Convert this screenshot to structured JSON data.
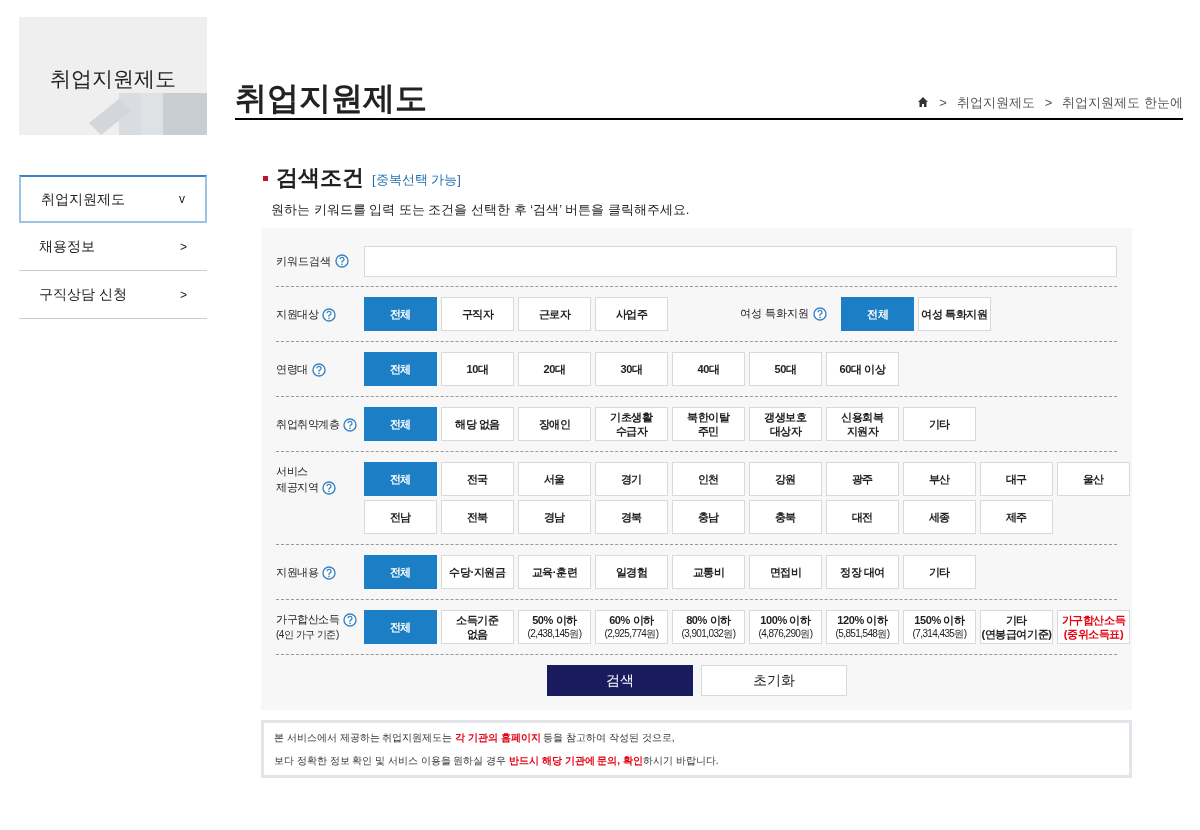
{
  "sidebar": {
    "banner_title": "취업지원제도",
    "items": [
      {
        "label": "취업지원제도",
        "arrow": "v",
        "selected": true
      },
      {
        "label": "채용정보",
        "arrow": ">",
        "selected": false
      },
      {
        "label": "구직상담 신청",
        "arrow": ">",
        "selected": false
      }
    ]
  },
  "header": {
    "title": "취업지원제도",
    "breadcrumb": [
      ">",
      "취업지원제도",
      ">",
      "취업지원제도 한눈에"
    ]
  },
  "section": {
    "title": "검색조건",
    "note": "[중복선택 가능]",
    "description": "원하는 키워드를 입력 또는 조건을 선택한 후 ‘검색’ 버튼을 클릭해주세요."
  },
  "filters": [
    {
      "kind": "keyword",
      "label": "키워드검색"
    },
    {
      "kind": "options",
      "label": "지원대상",
      "groups": [
        {
          "options": [
            {
              "label": "전체",
              "selected": true
            },
            {
              "label": "구직자",
              "selected": false
            },
            {
              "label": "근로자",
              "selected": false
            },
            {
              "label": "사업주",
              "selected": false
            }
          ]
        },
        {
          "label": "여성 특화지원",
          "options": [
            {
              "label": "전체",
              "selected": true
            },
            {
              "label": "여성 특화지원",
              "selected": false
            }
          ]
        }
      ]
    },
    {
      "kind": "options",
      "label": "연령대",
      "groups": [
        {
          "options": [
            {
              "label": "전체",
              "selected": true
            },
            {
              "label": "10대",
              "selected": false
            },
            {
              "label": "20대",
              "selected": false
            },
            {
              "label": "30대",
              "selected": false
            },
            {
              "label": "40대",
              "selected": false
            },
            {
              "label": "50대",
              "selected": false
            },
            {
              "label": "60대 이상",
              "selected": false
            }
          ]
        }
      ]
    },
    {
      "kind": "options",
      "label": "취업취약계층",
      "groups": [
        {
          "options": [
            {
              "label": "전체",
              "selected": true
            },
            {
              "label": "해당 없음",
              "selected": false
            },
            {
              "label": "장애인",
              "selected": false
            },
            {
              "label": "기초생활\n수급자",
              "selected": false
            },
            {
              "label": "북한이탈\n주민",
              "selected": false
            },
            {
              "label": "갱생보호\n대상자",
              "selected": false
            },
            {
              "label": "신용회복\n지원자",
              "selected": false
            },
            {
              "label": "기타",
              "selected": false
            }
          ]
        }
      ]
    },
    {
      "kind": "options",
      "label": "서비스\n제공지역",
      "groups": [
        {
          "options": [
            {
              "label": "전체",
              "selected": true
            },
            {
              "label": "전국",
              "selected": false
            },
            {
              "label": "서울",
              "selected": false
            },
            {
              "label": "경기",
              "selected": false
            },
            {
              "label": "인천",
              "selected": false
            },
            {
              "label": "강원",
              "selected": false
            },
            {
              "label": "광주",
              "selected": false
            },
            {
              "label": "부산",
              "selected": false
            },
            {
              "label": "대구",
              "selected": false
            },
            {
              "label": "울산",
              "selected": false
            },
            {
              "label": "전남",
              "selected": false
            },
            {
              "label": "전북",
              "selected": false
            },
            {
              "label": "경남",
              "selected": false
            },
            {
              "label": "경북",
              "selected": false
            },
            {
              "label": "충남",
              "selected": false
            },
            {
              "label": "충북",
              "selected": false
            },
            {
              "label": "대전",
              "selected": false
            },
            {
              "label": "세종",
              "selected": false
            },
            {
              "label": "제주",
              "selected": false
            }
          ]
        }
      ]
    },
    {
      "kind": "options",
      "label": "지원내용",
      "groups": [
        {
          "options": [
            {
              "label": "전체",
              "selected": true
            },
            {
              "label": "수당·지원금",
              "selected": false
            },
            {
              "label": "교육·훈련",
              "selected": false
            },
            {
              "label": "일경험",
              "selected": false
            },
            {
              "label": "교통비",
              "selected": false
            },
            {
              "label": "면접비",
              "selected": false
            },
            {
              "label": "정장 대여",
              "selected": false
            },
            {
              "label": "기타",
              "selected": false
            }
          ]
        }
      ]
    },
    {
      "kind": "options",
      "label": "가구합산소득",
      "sublabel": "(4인 가구 기준)",
      "groups": [
        {
          "options": [
            {
              "label": "전체",
              "selected": true
            },
            {
              "label": "소득기준\n없음",
              "selected": false
            },
            {
              "label": "50% 이하",
              "amount": "(2,438,145원)",
              "selected": false
            },
            {
              "label": "60% 이하",
              "amount": "(2,925,774원)",
              "selected": false
            },
            {
              "label": "80% 이하",
              "amount": "(3,901,032원)",
              "selected": false
            },
            {
              "label": "100% 이하",
              "amount": "(4,876,290원)",
              "selected": false
            },
            {
              "label": "120% 이하",
              "amount": "(5,851,548원)",
              "selected": false
            },
            {
              "label": "150% 이하",
              "amount": "(7,314,435원)",
              "selected": false
            },
            {
              "label": "기타\n(연봉급여기준)",
              "selected": false
            },
            {
              "label": "가구합산소득\n(중위소득표)",
              "kind": "link",
              "selected": false
            }
          ]
        }
      ]
    }
  ],
  "actions": [
    {
      "label": "검색",
      "kind": "primary"
    },
    {
      "label": "초기화",
      "kind": "secondary"
    }
  ],
  "notice": [
    "본 서비스에서 제공하는 취업지원제도는 **각 기관의 홈페이지** 등을 참고하여 작성된 것으로,",
    "보다 정확한 정보 확인 및 서비스 이용을 원하실 경우 **반드시 해당 기관에 문의, 확인**하시기 바랍니다."
  ]
}
